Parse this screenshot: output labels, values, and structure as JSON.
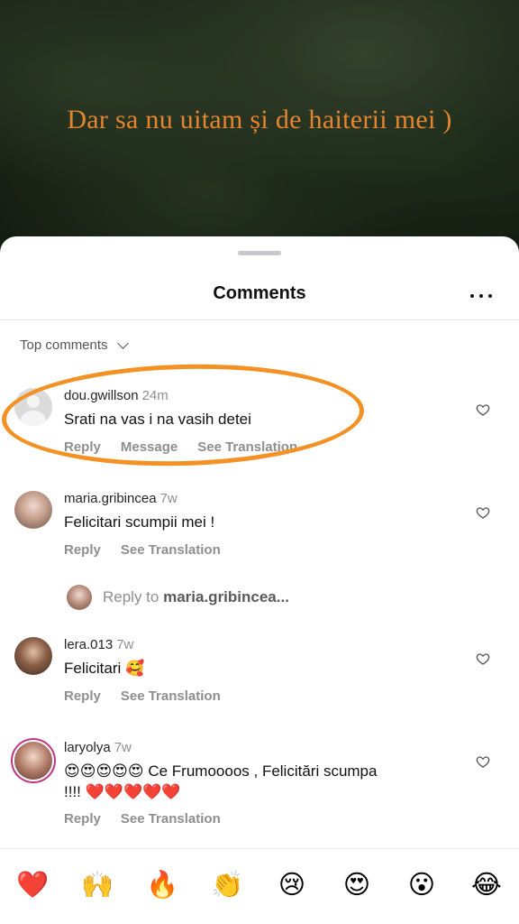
{
  "story": {
    "caption": "Dar sa nu uitam și de haiterii mei )"
  },
  "sheet": {
    "title": "Comments",
    "sort_label": "Top comments"
  },
  "comments": [
    {
      "username": "dou.gwillson",
      "time": "24m",
      "text": "Srati na vas i na vasih detei",
      "actions": [
        "Reply",
        "Message",
        "See Translation"
      ],
      "avatar": "default-avatar",
      "highlighted": true
    },
    {
      "username": "maria.gribincea",
      "time": "7w",
      "text": "Felicitari scumpii mei !",
      "actions": [
        "Reply",
        "See Translation"
      ],
      "avatar": "photo-avatar"
    },
    {
      "username": "lera.013",
      "time": "7w",
      "text": "Felicitari 🥰",
      "actions": [
        "Reply",
        "See Translation"
      ],
      "avatar": "photo-avatar"
    },
    {
      "username": "laryolya",
      "time": "7w",
      "text_line1": "😍😍😍😍😍 Ce Frumoooos , Felicitări scumpa",
      "text_line2": "!!!! ❤️❤️❤️❤️❤️",
      "actions": [
        "Reply",
        "See Translation"
      ],
      "avatar": "photo-avatar-story-ring"
    }
  ],
  "reply_prompt": {
    "prefix": "Reply to ",
    "target": "maria.gribincea..."
  },
  "emoji_bar": [
    "❤️",
    "🙌",
    "🔥",
    "👏",
    "😢",
    "😍",
    "😮",
    "😂"
  ],
  "colors": {
    "caption": "#e5852f",
    "highlight_ring": "#f39124",
    "secondary_text": "#8e8e8e"
  }
}
